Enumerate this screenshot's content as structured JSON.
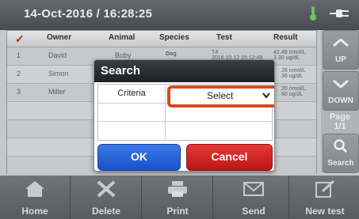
{
  "header": {
    "datetime": "14-Oct-2016 / 16:28:25"
  },
  "table": {
    "headers": [
      "Owner",
      "Animal",
      "Species",
      "Test",
      "Result"
    ],
    "rows": [
      {
        "num": "1",
        "owner": "David",
        "animal": "Boby",
        "species": "Dog",
        "test_line1": "T4",
        "test_line2": "2016.10.12 15:12:49",
        "result_line1": "42.48 nmol/L",
        "result_line2": "3.30 ug/dL"
      },
      {
        "num": "2",
        "owner": "Simon",
        "animal": "",
        "species": "",
        "test_line1": "",
        "test_line2": "",
        "result_line1": "28 nmol/L",
        "result_line2": "36 ug/dL"
      },
      {
        "num": "3",
        "owner": "Miller",
        "animal": "",
        "species": "",
        "test_line1": "",
        "test_line2": "",
        "result_line1": "20 nmol/L",
        "result_line2": "60 ug/dL"
      }
    ]
  },
  "sidebar": {
    "up": "UP",
    "down": "DOWN",
    "page_label": "Page",
    "page_value": "1/1",
    "search": "Search"
  },
  "bottom": {
    "home": "Home",
    "delete": "Delete",
    "print": "Print",
    "send": "Send",
    "new_test": "New test"
  },
  "dialog": {
    "title": "Search",
    "criteria_label": "Criteria",
    "select_value": "Select",
    "ok": "OK",
    "cancel": "Cancel"
  }
}
